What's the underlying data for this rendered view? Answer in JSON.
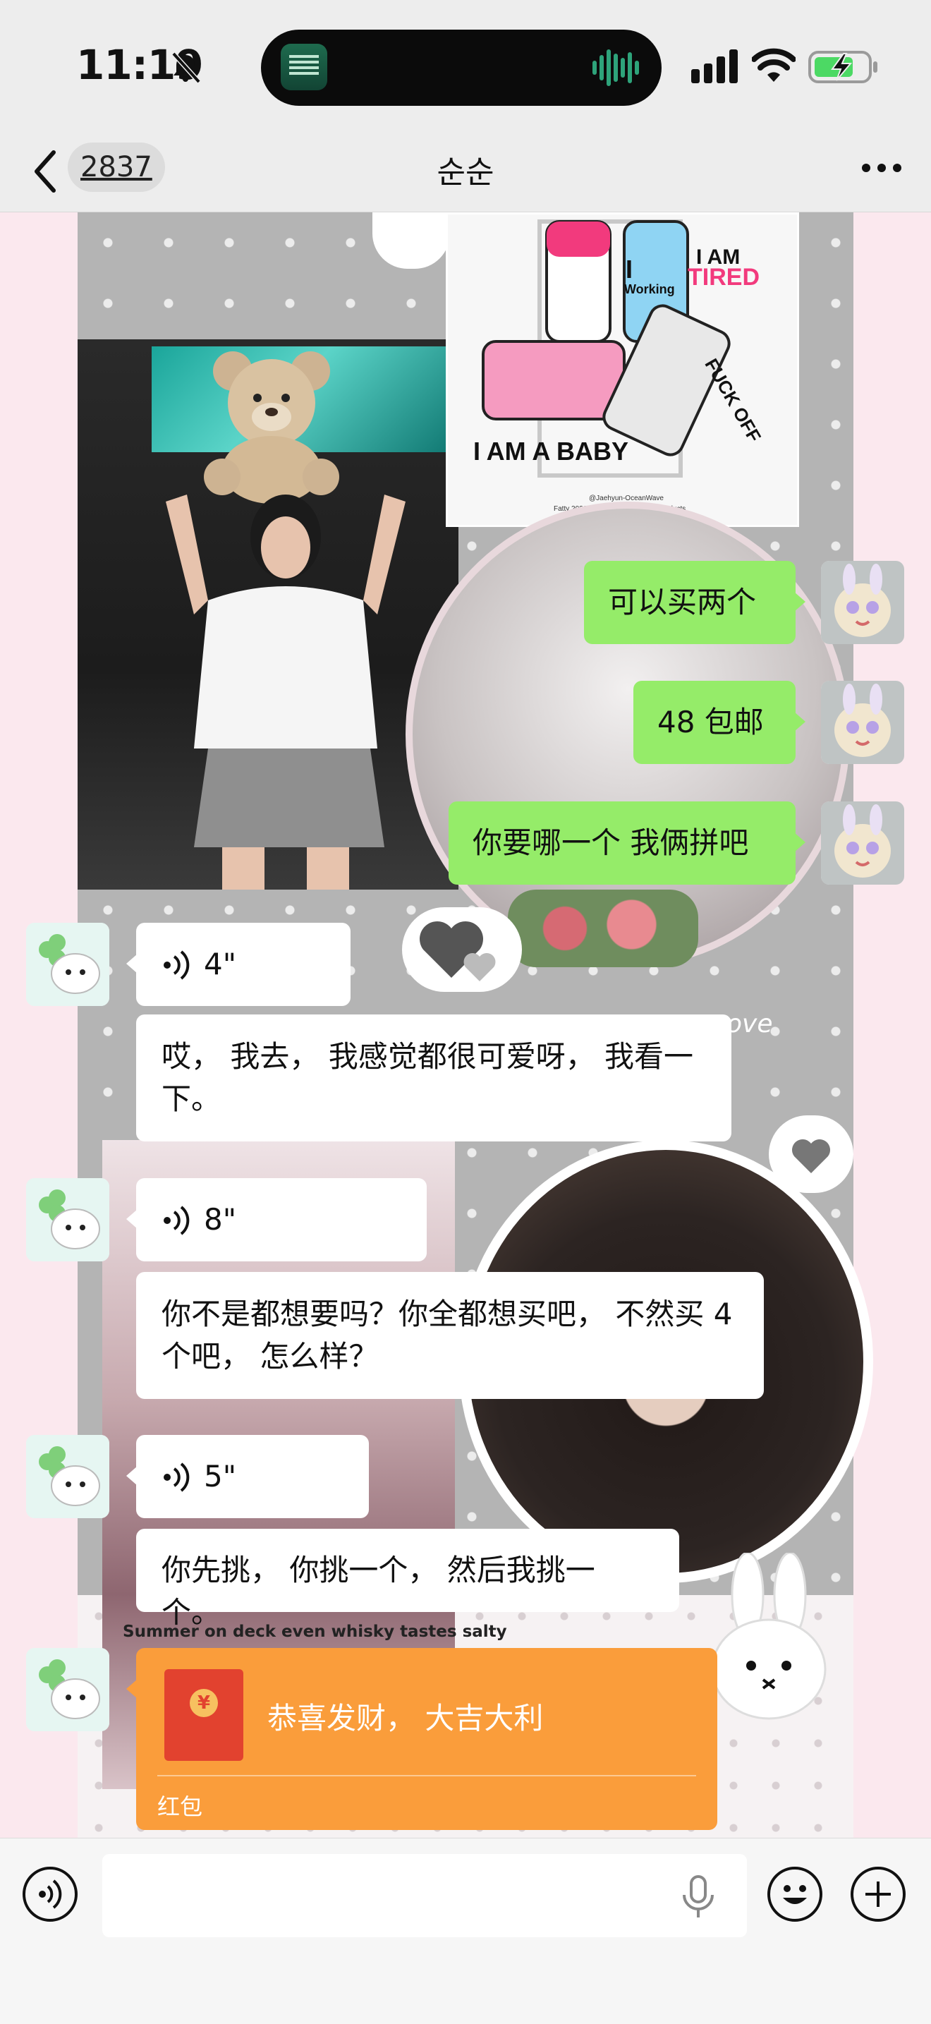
{
  "status_bar": {
    "time": "11:19",
    "icons": [
      "bell-slash-icon",
      "signal-icon",
      "wifi-icon",
      "battery-charging-icon"
    ]
  },
  "nav": {
    "unread_count": "2837",
    "title": "순순",
    "back_icon": "chevron-left-icon",
    "more_icon": "ellipsis-icon"
  },
  "wallpaper_text": {
    "sticker_sheet": {
      "line1": "I AM",
      "line2": "TIRED",
      "line3": "I",
      "line4": "Working",
      "line5": "I AM A BABY",
      "line6": "FUCK OFF",
      "credit1": "@Jaehyun-OceanWave",
      "credit2": "Fatty 2026 Summer Season-NewProducts"
    },
    "love_text": "ove"
  },
  "messages": [
    {
      "from": "me",
      "type": "text",
      "text": "可以买两个"
    },
    {
      "from": "me",
      "type": "text",
      "text": "48 包邮"
    },
    {
      "from": "me",
      "type": "text",
      "text": "你要哪一个 我俩拼吧"
    },
    {
      "from": "friend",
      "type": "voice",
      "duration": "4\""
    },
    {
      "from": "friend",
      "type": "text",
      "text": "哎， 我去， 我感觉都很可爱呀， 我看一下。"
    },
    {
      "from": "friend",
      "type": "voice",
      "duration": "8\""
    },
    {
      "from": "friend",
      "type": "text",
      "text": "你不是都想要吗？你全都想买吧， 不然买 4 个吧， 怎么样？"
    },
    {
      "from": "friend",
      "type": "voice",
      "duration": "5\""
    },
    {
      "from": "friend",
      "type": "text",
      "text": "你先挑， 你挑一个， 然后我挑一个。"
    },
    {
      "from": "friend",
      "type": "red_packet",
      "caption": "Summer on deck even whisky tastes salty",
      "title": "恭喜发财， 大吉大利",
      "label": "红包",
      "coin": "¥"
    }
  ],
  "input_bar": {
    "voice_icon": "voice-mode-icon",
    "mic_icon": "microphone-icon",
    "emoji_icon": "smiley-icon",
    "plus_icon": "plus-icon"
  },
  "colors": {
    "my_bubble": "#95ec69",
    "friend_bubble": "#ffffff",
    "red_packet": "#fa9d3b",
    "battery": "#4cd964"
  }
}
